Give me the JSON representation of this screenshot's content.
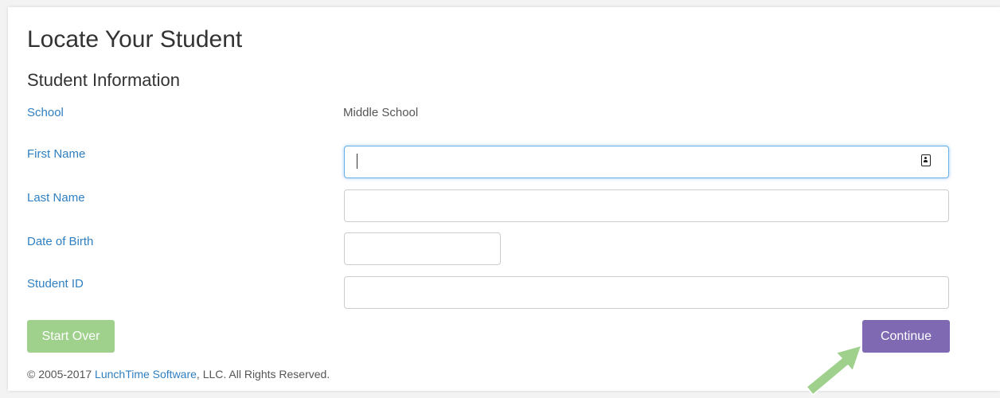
{
  "page": {
    "title": "Locate Your Student",
    "section_title": "Student Information"
  },
  "form": {
    "school": {
      "label": "School",
      "value": "Middle School"
    },
    "first_name": {
      "label": "First Name",
      "value": "",
      "placeholder": ""
    },
    "last_name": {
      "label": "Last Name",
      "value": "",
      "placeholder": ""
    },
    "dob": {
      "label": "Date of Birth",
      "value": "",
      "placeholder": ""
    },
    "student_id": {
      "label": "Student ID",
      "value": "",
      "placeholder": ""
    }
  },
  "buttons": {
    "start_over": "Start Over",
    "continue": "Continue"
  },
  "footer": {
    "prefix": "© 2005-2017 ",
    "link": "LunchTime Software",
    "suffix": ", LLC. All Rights Reserved."
  },
  "icons": {
    "autofill": "contact-card-icon",
    "annotation": "arrow-icon"
  },
  "colors": {
    "label": "#2f7fc1",
    "start_over_button": "#9fd18d",
    "continue_button": "#7f69b3",
    "annotation_arrow": "#9fd18d",
    "focus_border": "#66afe9"
  }
}
